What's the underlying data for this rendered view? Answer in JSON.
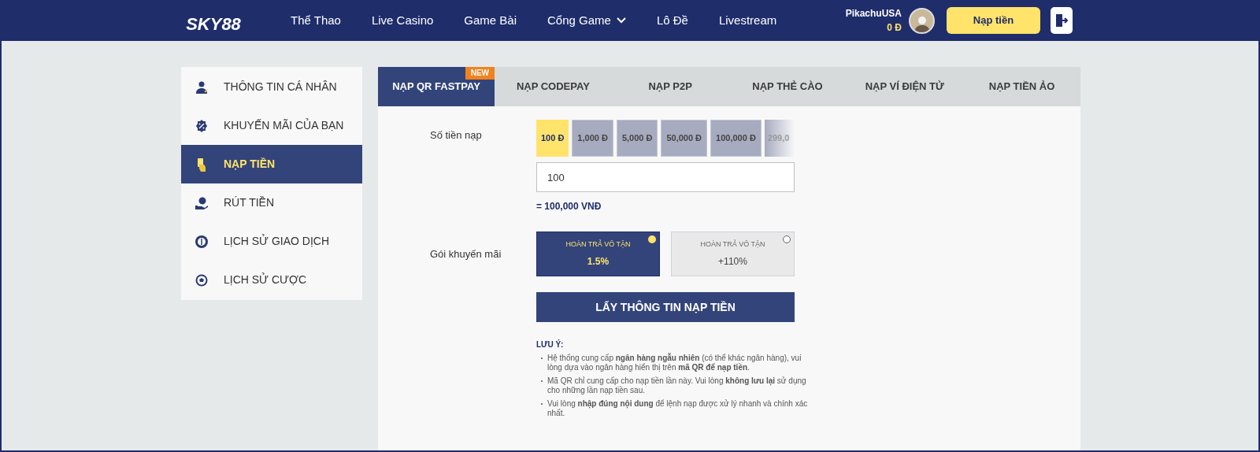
{
  "header": {
    "logo": "SKY88",
    "nav": [
      {
        "label": "Thể Thao",
        "dropdown": false
      },
      {
        "label": "Live Casino",
        "dropdown": false
      },
      {
        "label": "Game Bài",
        "dropdown": false
      },
      {
        "label": "Cổng Game",
        "dropdown": true
      },
      {
        "label": "Lô Đề",
        "dropdown": false
      },
      {
        "label": "Livestream",
        "dropdown": false
      }
    ],
    "username": "PikachuUSA",
    "balance": "0 Đ",
    "deposit_button": "Nạp tiền"
  },
  "sidebar": {
    "items": [
      {
        "label": "THÔNG TIN CÁ NHÂN",
        "kind": "user",
        "selected": false
      },
      {
        "label": "KHUYẾN MÃI CỦA BẠN",
        "kind": "percent",
        "selected": false
      },
      {
        "label": "NẠP TIỀN",
        "kind": "hand",
        "selected": true
      },
      {
        "label": "RÚT TIỀN",
        "kind": "withdraw",
        "selected": false
      },
      {
        "label": "LỊCH SỬ GIAO DỊCH",
        "kind": "history",
        "selected": false
      },
      {
        "label": "LỊCH SỬ CƯỢC",
        "kind": "ball",
        "selected": false
      }
    ]
  },
  "tabs": [
    {
      "label": "NẠP QR FASTPAY",
      "selected": true,
      "badge": "NEW"
    },
    {
      "label": "NẠP CODEPAY",
      "selected": false
    },
    {
      "label": "NẠP P2P",
      "selected": false
    },
    {
      "label": "NẠP THẺ CÀO",
      "selected": false
    },
    {
      "label": "NẠP VÍ ĐIỆN TỬ",
      "selected": false
    },
    {
      "label": "NẠP TIỀN ẢO",
      "selected": false
    }
  ],
  "amount": {
    "label": "Số tiền nạp",
    "chips": [
      {
        "label": "100 Đ",
        "selected": true
      },
      {
        "label": "1,000 Đ",
        "selected": false
      },
      {
        "label": "5,000 Đ",
        "selected": false
      },
      {
        "label": "50,000 Đ",
        "selected": false
      },
      {
        "label": "100,000 Đ",
        "selected": false
      },
      {
        "label": "299,0",
        "selected": false
      }
    ],
    "value": "100",
    "converted": "= 100,000 VNĐ"
  },
  "promotion": {
    "label": "Gói khuyến mãi",
    "options": [
      {
        "title": "HOÀN TRẢ VÔ TẬN",
        "value": "1.5%",
        "selected": true
      },
      {
        "title": "HOÀN TRẢ VÔ TẬN",
        "value": "+110%",
        "selected": false
      }
    ]
  },
  "submit_button": "LẤY THÔNG TIN NẠP TIỀN",
  "notes": {
    "title": "LƯU Ý:",
    "items": [
      "Hệ thống cung cấp **ngân hàng ngẫu nhiên** (có thể khác ngân hàng), vui lòng dựa vào ngân hàng hiển thị trên **mã QR để nạp tiền**.",
      "Mã QR chỉ cung cấp cho nạp tiền lần này. Vui lòng **không lưu lại** sử dụng cho những lần nạp tiền sau.",
      "Vui lòng **nhập đúng nội dung** để lệnh nạp được xử lý nhanh và chính xác nhất."
    ]
  }
}
